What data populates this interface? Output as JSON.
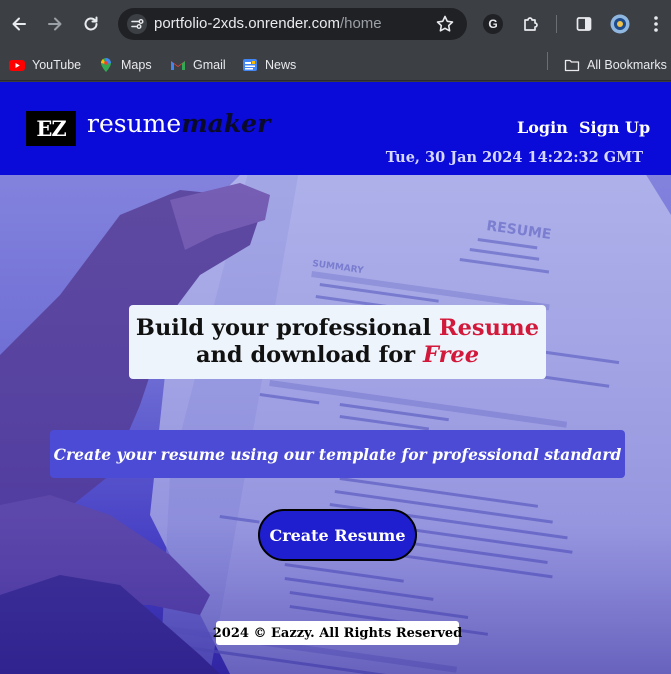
{
  "browser": {
    "url_host": "portfolio-2xds.onrender.com",
    "url_path": "/home",
    "bookmarks": [
      {
        "label": "YouTube",
        "icon": "youtube-icon"
      },
      {
        "label": "Maps",
        "icon": "maps-icon"
      },
      {
        "label": "Gmail",
        "icon": "gmail-icon"
      },
      {
        "label": "News",
        "icon": "news-icon"
      }
    ],
    "all_bookmarks_label": "All Bookmarks",
    "google_badge": "G"
  },
  "header": {
    "logo_mark": "EZ",
    "logo_word_1": "resume",
    "logo_word_2": "maker",
    "login_label": "Login",
    "signup_label": "Sign Up",
    "clock": "Tue, 30 Jan 2024 14:22:32 GMT",
    "bg_color": "#0a0ad9"
  },
  "hero": {
    "headline_part1": "Build your professional ",
    "headline_highlight1": "Resume",
    "headline_part2": "and download for ",
    "headline_highlight2": "Free",
    "subtitle": "Create your resume using our template for professional standard",
    "cta_label": "Create Resume",
    "accent_color": "#d2193b"
  },
  "footer": {
    "text": "2024 © Eazzy. All Rights Reserved"
  }
}
